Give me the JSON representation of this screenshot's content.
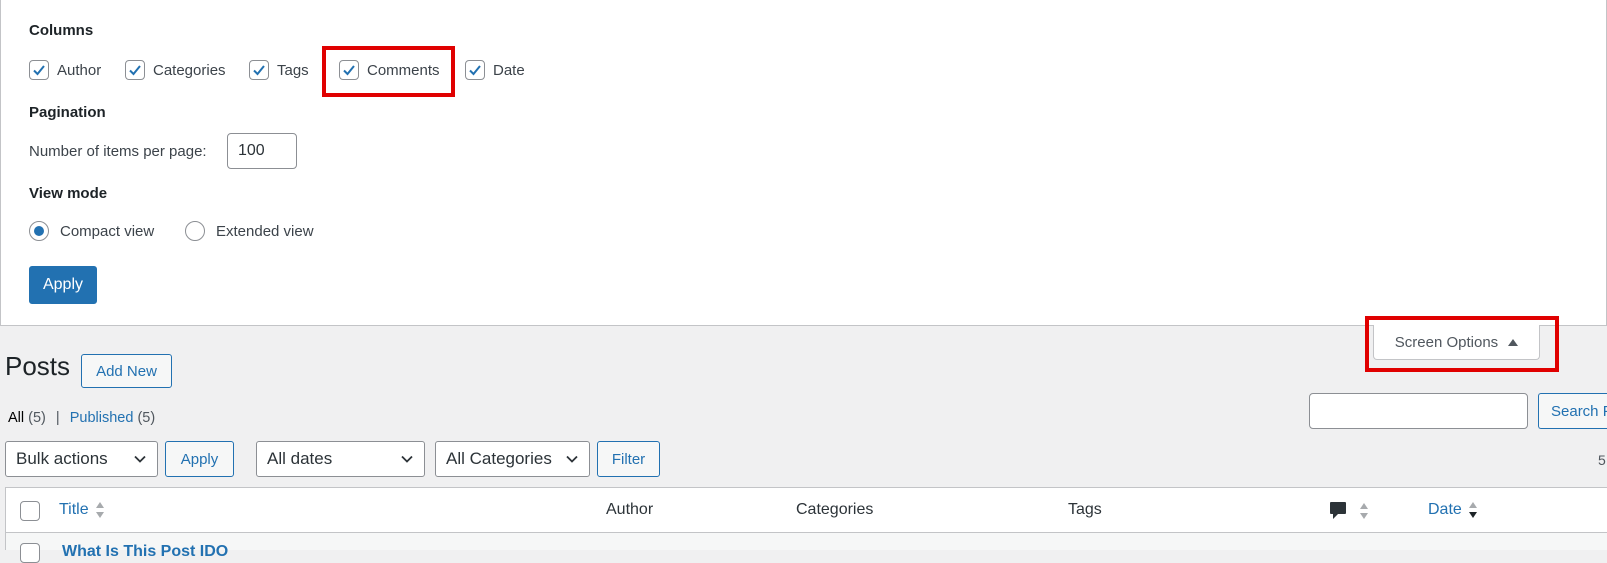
{
  "screen_options": {
    "columns_legend": "Columns",
    "columns": [
      {
        "label": "Author",
        "checked": true
      },
      {
        "label": "Categories",
        "checked": true
      },
      {
        "label": "Tags",
        "checked": true
      },
      {
        "label": "Comments",
        "checked": true
      },
      {
        "label": "Date",
        "checked": true
      }
    ],
    "pagination_legend": "Pagination",
    "items_per_page_label": "Number of items per page:",
    "items_per_page_value": "100",
    "view_mode_legend": "View mode",
    "view_modes": [
      {
        "label": "Compact view",
        "selected": true
      },
      {
        "label": "Extended view",
        "selected": false
      }
    ],
    "apply_label": "Apply",
    "tab_label": "Screen Options"
  },
  "posts": {
    "title": "Posts",
    "add_new_label": "Add New",
    "filters": {
      "all_label": "All",
      "all_count": "(5)",
      "separator": "|",
      "published_label": "Published",
      "published_count": "(5)"
    },
    "search_button_label": "Search P",
    "bulk_actions": {
      "selected": "Bulk actions",
      "apply_label": "Apply"
    },
    "date_filter": {
      "selected": "All dates"
    },
    "category_filter": {
      "selected": "All Categories"
    },
    "filter_label": "Filter",
    "items_count": "5",
    "table": {
      "headers": {
        "title": "Title",
        "author": "Author",
        "categories": "Categories",
        "tags": "Tags",
        "date": "Date"
      },
      "first_row_title": "What Is This Post IDO"
    }
  },
  "colors": {
    "accent": "#2271b1",
    "highlight": "#e00000",
    "background": "#f0f0f1"
  }
}
